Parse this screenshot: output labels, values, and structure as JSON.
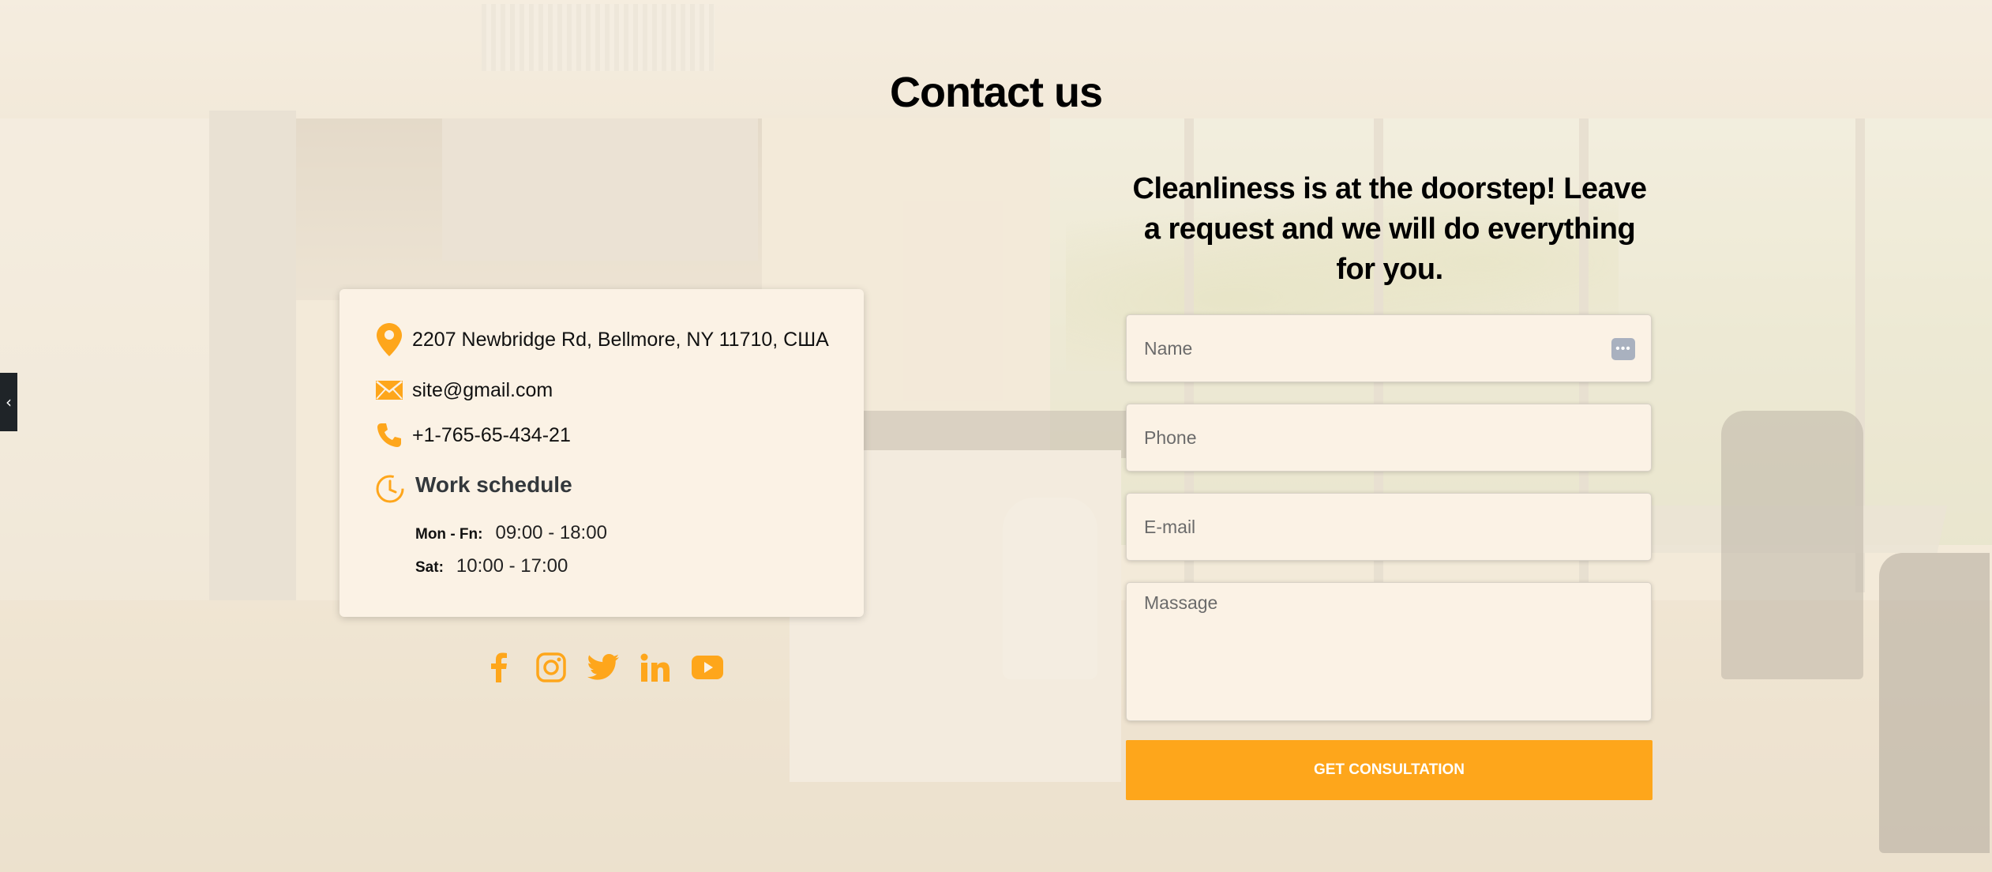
{
  "section": {
    "title": "Contact us"
  },
  "contact": {
    "address": "2207 Newbridge Rd, Bellmore, NY 11710, США",
    "email": "site@gmail.com",
    "phone": "+1-765-65-434-21",
    "schedule_title": "Work schedule",
    "schedule": [
      {
        "day": "Mon - Fn:",
        "hours": "09:00 - 18:00"
      },
      {
        "day": "Sat:",
        "hours": "10:00 - 17:00"
      }
    ]
  },
  "socials": [
    {
      "icon": "facebook-icon"
    },
    {
      "icon": "instagram-icon"
    },
    {
      "icon": "twitter-icon"
    },
    {
      "icon": "linkedin-icon"
    },
    {
      "icon": "youtube-icon"
    }
  ],
  "form": {
    "heading": "Cleanliness is at the doorstep! Leave a request and we will do everything for you.",
    "name_placeholder": "Name",
    "phone_placeholder": "Phone",
    "email_placeholder": "E-mail",
    "message_placeholder": "Massage",
    "submit_label": "GET CONSULTATION"
  },
  "side_tab": {
    "glyph": "‹"
  },
  "colors": {
    "accent": "#fea61b",
    "card": "#fbf2e5",
    "side_tab": "#1f2428"
  }
}
